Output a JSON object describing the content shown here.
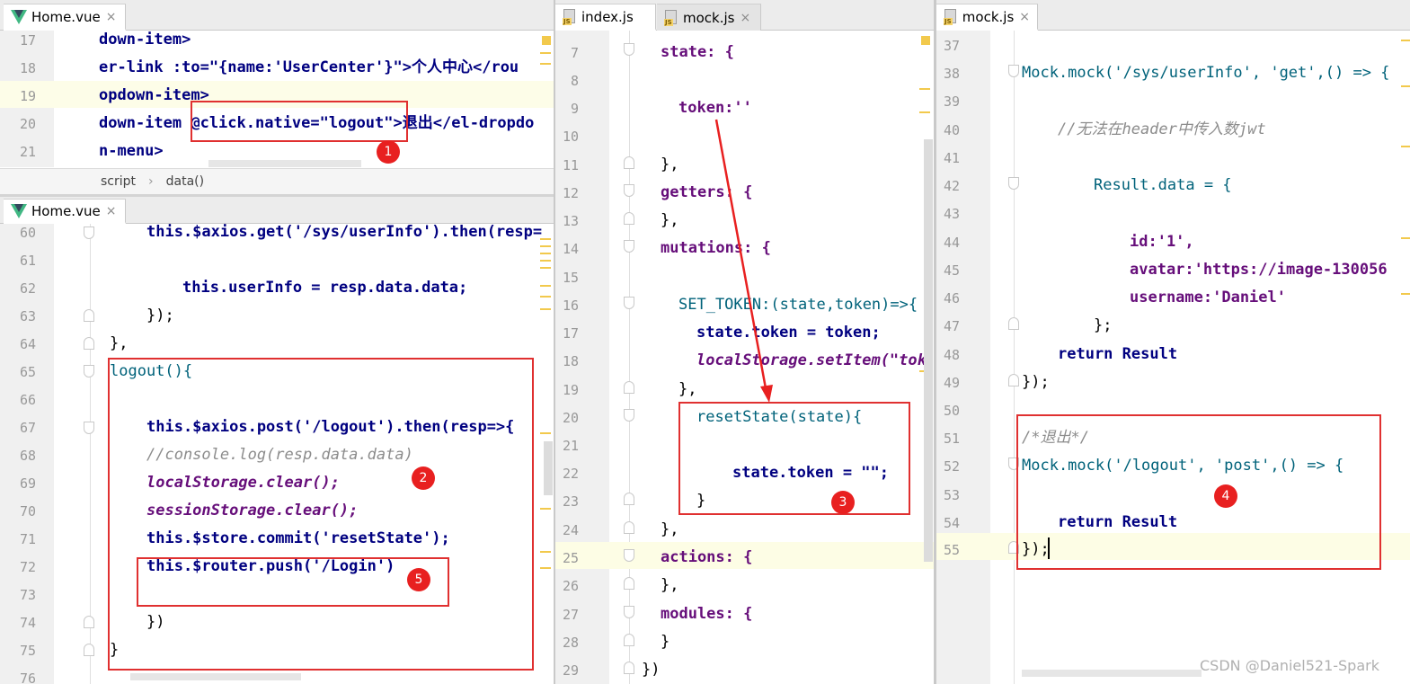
{
  "pane1": {
    "tab_label": "Home.vue",
    "close": "×",
    "lines": [
      {
        "num": "17",
        "text": "down-item>"
      },
      {
        "num": "18",
        "text": "er-link :to=\"{name:'UserCenter'}\">个人中心</rou"
      },
      {
        "num": "19",
        "text": "opdown-item>"
      },
      {
        "num": "20",
        "text": "down-item @click.native=\"logout\">退出</el-dropdo"
      },
      {
        "num": "21",
        "text": "n-menu>"
      }
    ],
    "breadcrumb": [
      "script",
      "data()"
    ],
    "breadcrumb_sep": "›"
  },
  "pane2": {
    "tab_label": "Home.vue",
    "close": "×",
    "lines": [
      {
        "num": "60",
        "text": "this.$axios.get('/sys/userInfo').then(resp="
      },
      {
        "num": "61",
        "text": ""
      },
      {
        "num": "62",
        "text": "this.userInfo = resp.data.data;"
      },
      {
        "num": "63",
        "text": "});"
      },
      {
        "num": "64",
        "text": "},"
      },
      {
        "num": "65",
        "text": "logout(){"
      },
      {
        "num": "66",
        "text": ""
      },
      {
        "num": "67",
        "text": "this.$axios.post('/logout').then(resp=>{"
      },
      {
        "num": "68",
        "text": "//console.log(resp.data.data)"
      },
      {
        "num": "69",
        "text": "localStorage.clear();"
      },
      {
        "num": "70",
        "text": "sessionStorage.clear();"
      },
      {
        "num": "71",
        "text": "this.$store.commit('resetState');"
      },
      {
        "num": "72",
        "text": "this.$router.push('/Login')"
      },
      {
        "num": "73",
        "text": ""
      },
      {
        "num": "74",
        "text": "})"
      },
      {
        "num": "75",
        "text": "}"
      },
      {
        "num": "76",
        "text": ""
      }
    ]
  },
  "pane3": {
    "tabs": [
      {
        "label": "index.js",
        "close": ""
      },
      {
        "label": "mock.js",
        "close": "×"
      }
    ],
    "lines": [
      {
        "num": "7",
        "text": "state: {"
      },
      {
        "num": "8",
        "text": ""
      },
      {
        "num": "9",
        "text": "token:''"
      },
      {
        "num": "10",
        "text": ""
      },
      {
        "num": "11",
        "text": "},"
      },
      {
        "num": "12",
        "text": "getters: {"
      },
      {
        "num": "13",
        "text": "},"
      },
      {
        "num": "14",
        "text": "mutations: {"
      },
      {
        "num": "15",
        "text": ""
      },
      {
        "num": "16",
        "text": "SET_TOKEN:(state,token)=>{"
      },
      {
        "num": "17",
        "text": "state.token = token;"
      },
      {
        "num": "18",
        "text": "localStorage.setItem(\"tok"
      },
      {
        "num": "19",
        "text": "},"
      },
      {
        "num": "20",
        "text": "resetState(state){"
      },
      {
        "num": "21",
        "text": ""
      },
      {
        "num": "22",
        "text": "state.token = \"\";"
      },
      {
        "num": "23",
        "text": "}"
      },
      {
        "num": "24",
        "text": "},"
      },
      {
        "num": "25",
        "text": "actions: {"
      },
      {
        "num": "26",
        "text": "},"
      },
      {
        "num": "27",
        "text": "modules: {"
      },
      {
        "num": "28",
        "text": "}"
      },
      {
        "num": "29",
        "text": "})"
      }
    ]
  },
  "pane4": {
    "tab_label": "mock.js",
    "close": "×",
    "lines": [
      {
        "num": "37",
        "text": ""
      },
      {
        "num": "38",
        "text": "Mock.mock('/sys/userInfo', 'get',() => {"
      },
      {
        "num": "39",
        "text": ""
      },
      {
        "num": "40",
        "text": "//无法在header中传入数jwt"
      },
      {
        "num": "41",
        "text": ""
      },
      {
        "num": "42",
        "text": "Result.data = {"
      },
      {
        "num": "43",
        "text": ""
      },
      {
        "num": "44",
        "text": "id:'1',"
      },
      {
        "num": "45",
        "text": "avatar:'https://image-130056"
      },
      {
        "num": "46",
        "text": "username:'Daniel'"
      },
      {
        "num": "47",
        "text": "};"
      },
      {
        "num": "48",
        "text": "return Result"
      },
      {
        "num": "49",
        "text": "});"
      },
      {
        "num": "50",
        "text": ""
      },
      {
        "num": "51",
        "text": "/*退出*/"
      },
      {
        "num": "52",
        "text": "Mock.mock('/logout', 'post',() => {"
      },
      {
        "num": "53",
        "text": ""
      },
      {
        "num": "54",
        "text": "return Result"
      },
      {
        "num": "55",
        "text": "});"
      }
    ]
  },
  "annotations": [
    "1",
    "2",
    "3",
    "4",
    "5"
  ],
  "watermark": "CSDN @Daniel521-Spark",
  "colors": {
    "annotation_red": "#e03030",
    "keyword": "#000080",
    "string": "#067d17",
    "highlight": "#fdfde5"
  }
}
